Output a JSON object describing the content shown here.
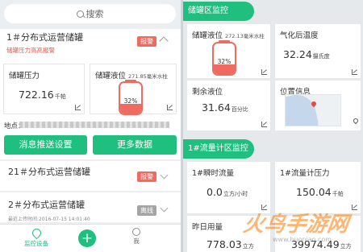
{
  "left": {
    "search_placeholder": "搜索",
    "tank1": {
      "title": "1＃分布式运营储罐",
      "alert": "储罐压力高高报警",
      "badge": "报警",
      "pressure_label": "储罐压力",
      "pressure_value": "722.16",
      "pressure_unit": "千帕",
      "level_label": "储罐液位",
      "level_small": "271.85毫米水柱",
      "level_percent": "32%",
      "level_fraction": 0.32,
      "location_label": "地点：",
      "btn_notify": "消息推送设置",
      "btn_more": "更多数据"
    },
    "tank21": {
      "title": "21＃分布式运营储罐",
      "badge": "报警"
    },
    "tank2": {
      "title": "2＃分布式运营储罐",
      "badge": "离线",
      "last_upload": "最近上传时间:2016-07-15 14:01:40"
    },
    "tabs": {
      "monitor": "监控设备",
      "me": "我"
    }
  },
  "right": {
    "sec1": "储罐区监控",
    "level_label": "储罐液位",
    "level_small": "272.13毫米水柱",
    "level_percent": "32%",
    "level_fraction": 0.32,
    "gas_temp_label": "气化后温度",
    "gas_temp_value": "32.24",
    "gas_temp_unit": "摄氏度",
    "remain_label": "剩余液位",
    "remain_value": "31.64",
    "remain_unit": "百分比",
    "location_label": "位置信息",
    "sec2": "1#流量计区监控",
    "flow_label": "1#瞬时流量",
    "flow_value": "0.0",
    "flow_unit": "立方/小时",
    "flow_pressure_label": "1#流量计压力",
    "flow_pressure_value": "150.04",
    "flow_pressure_unit": "千帕",
    "yesterday_label": "昨日用量",
    "yesterday_value": "778.03",
    "yesterday_unit": "立方",
    "total_value": "39974.49",
    "total_unit": "立方"
  },
  "colors": {
    "accent": "#1fbf7f",
    "alert": "#ef6b62",
    "offline": "#a4a4a4"
  }
}
